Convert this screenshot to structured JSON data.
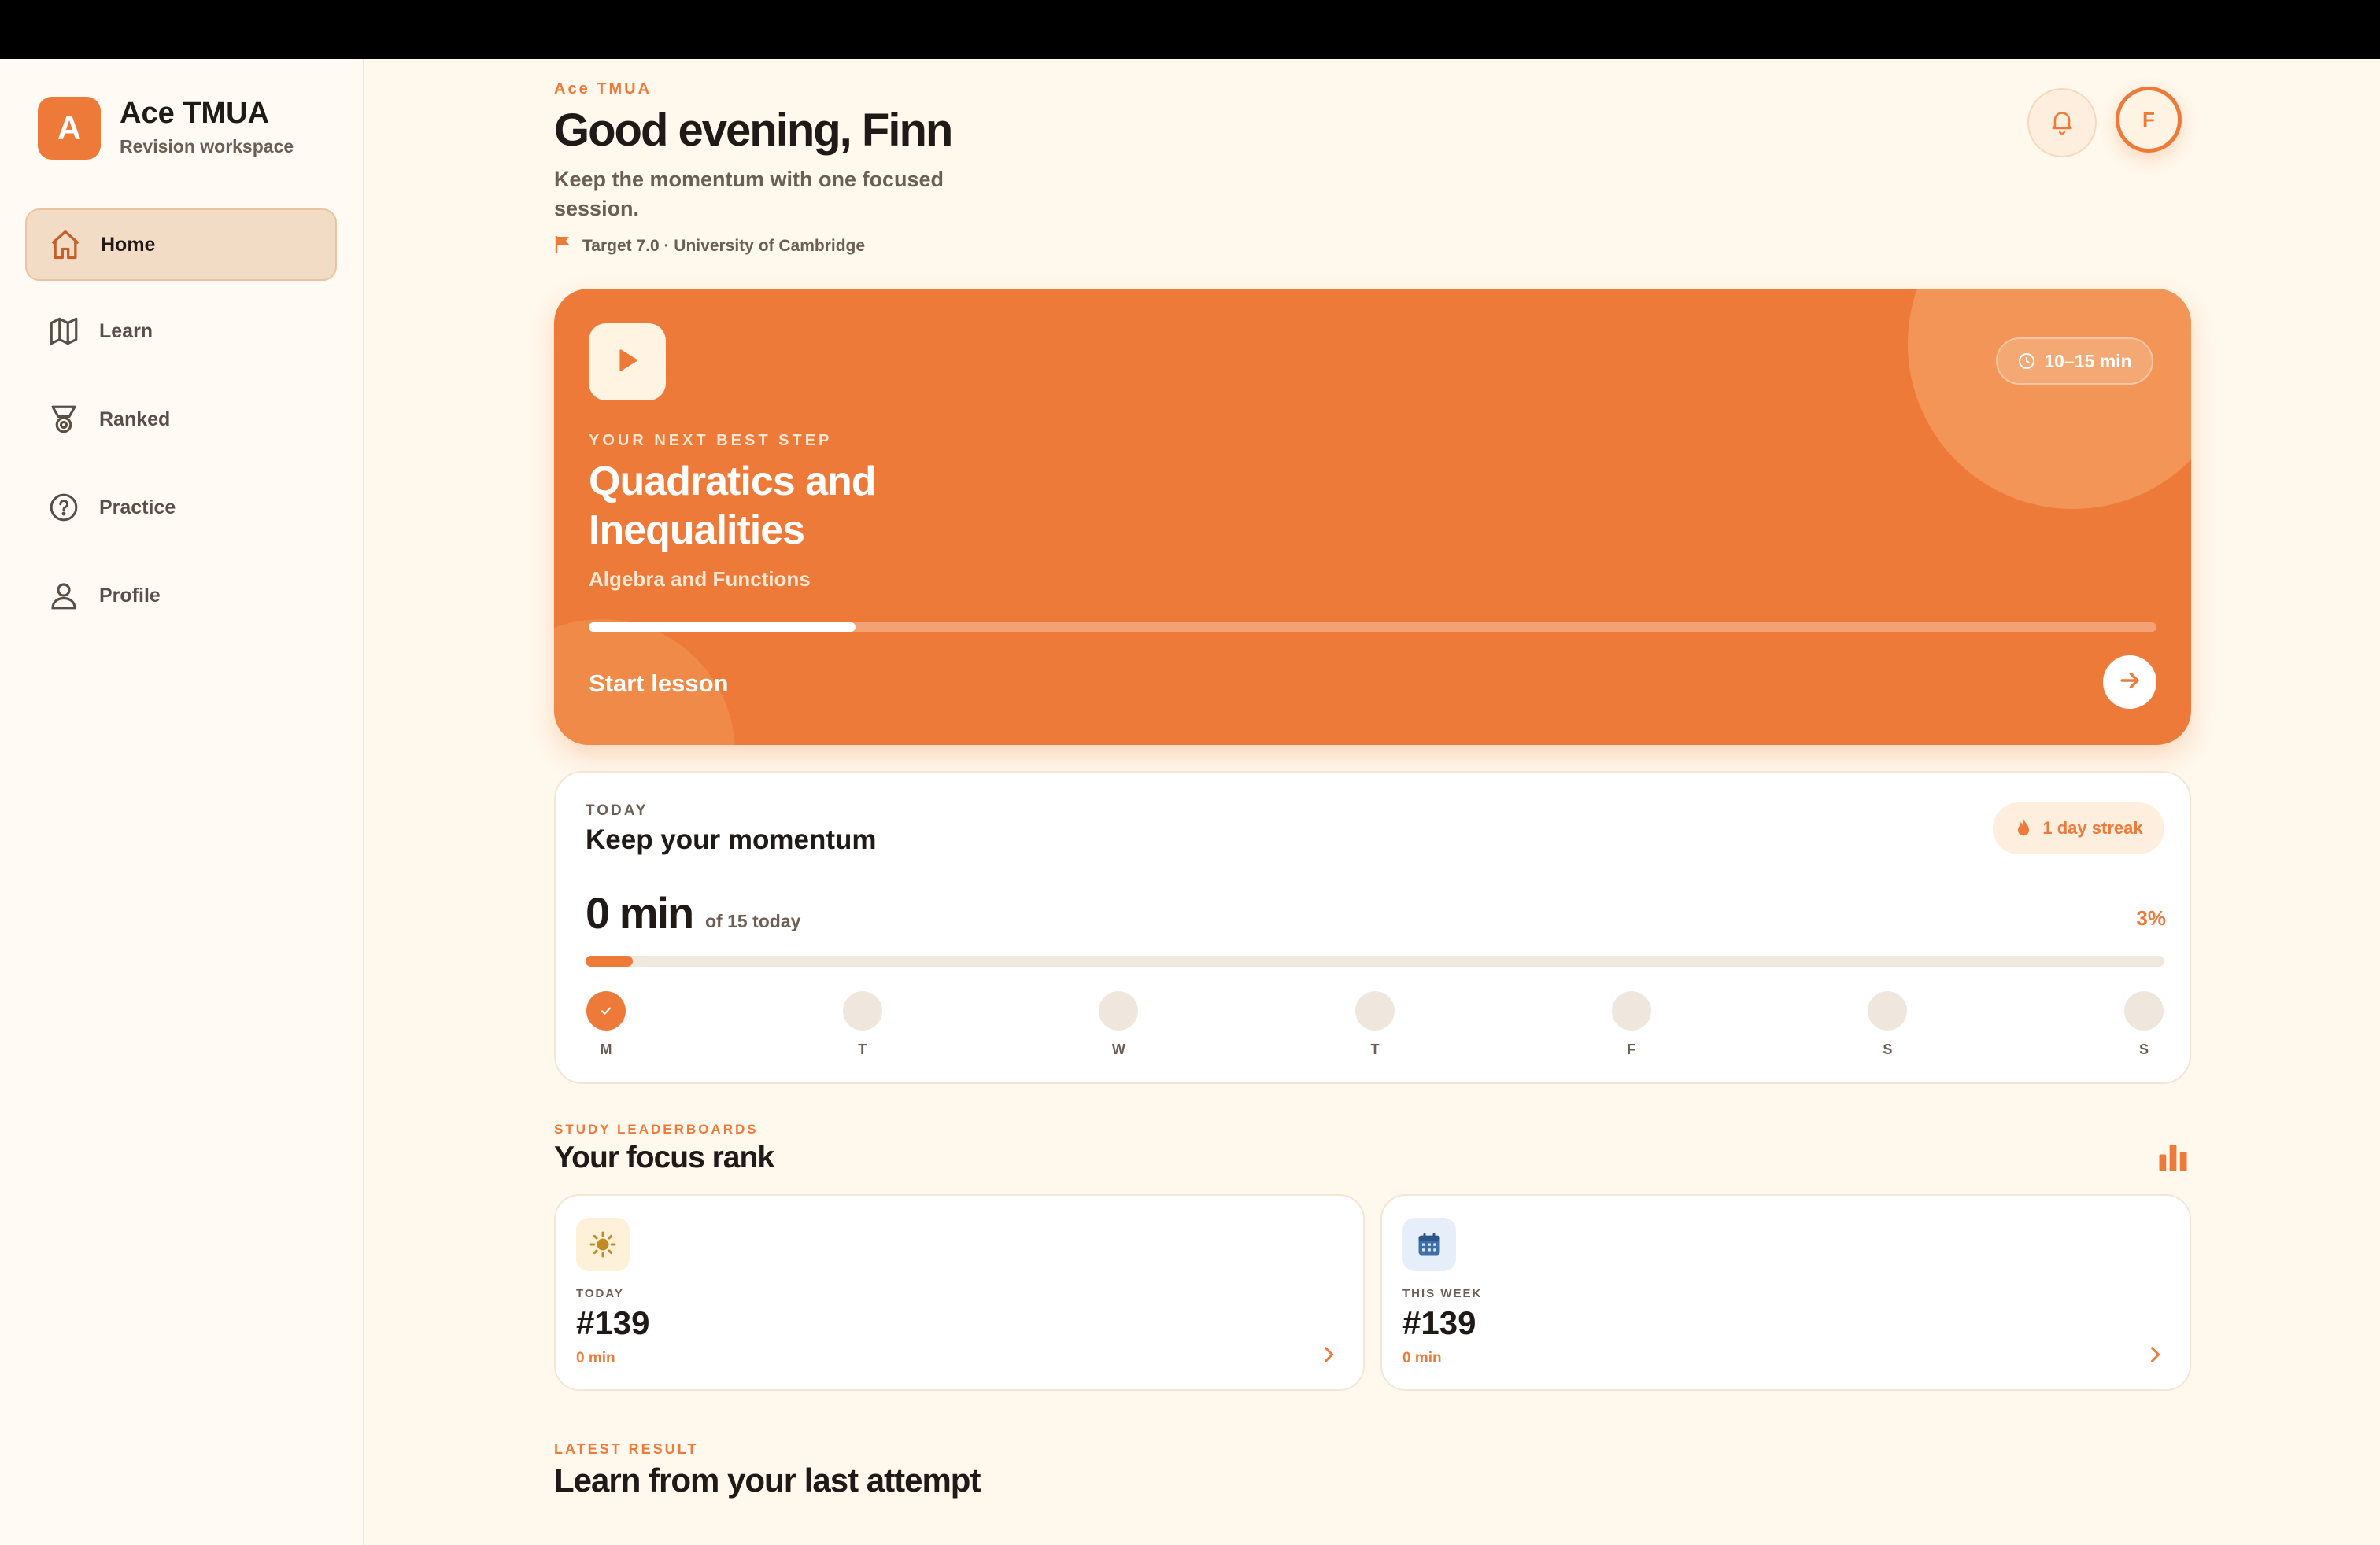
{
  "brand": {
    "logo_letter": "A",
    "title": "Ace TMUA",
    "subtitle": "Revision workspace"
  },
  "sidebar": {
    "items": [
      {
        "label": "Home",
        "icon": "home-icon",
        "active": true
      },
      {
        "label": "Learn",
        "icon": "map-icon",
        "active": false
      },
      {
        "label": "Ranked",
        "icon": "medal-icon",
        "active": false
      },
      {
        "label": "Practice",
        "icon": "question-circle-icon",
        "active": false
      },
      {
        "label": "Profile",
        "icon": "user-icon",
        "active": false
      }
    ]
  },
  "header": {
    "eyebrow": "Ace TMUA",
    "greeting": "Good evening, Finn",
    "subtitle": "Keep the momentum with one focused session.",
    "target": "Target 7.0 · University of Cambridge",
    "avatar_initial": "F"
  },
  "hero": {
    "duration": "10–15 min",
    "eyebrow": "YOUR NEXT BEST STEP",
    "title": "Quadratics and Inequalities",
    "subtitle": "Algebra and Functions",
    "progress": 0.17,
    "cta": "Start lesson"
  },
  "momentum": {
    "eyebrow": "TODAY",
    "title": "Keep your momentum",
    "streak": "1 day streak",
    "minutes": "0 min",
    "of_label": "of 15 today",
    "percent": "3%",
    "progress": 0.03,
    "days": [
      {
        "label": "M",
        "done": true
      },
      {
        "label": "T",
        "done": false
      },
      {
        "label": "W",
        "done": false
      },
      {
        "label": "T",
        "done": false
      },
      {
        "label": "F",
        "done": false
      },
      {
        "label": "S",
        "done": false
      },
      {
        "label": "S",
        "done": false
      }
    ]
  },
  "leaderboards": {
    "eyebrow": "STUDY LEADERBOARDS",
    "title": "Your focus rank",
    "cards": [
      {
        "eyebrow": "TODAY",
        "rank": "#139",
        "minutes": "0 min",
        "icon": "sun-icon"
      },
      {
        "eyebrow": "THIS WEEK",
        "rank": "#139",
        "minutes": "0 min",
        "icon": "calendar-icon"
      }
    ]
  },
  "latest_result": {
    "eyebrow": "LATEST RESULT",
    "title": "Learn from your last attempt"
  },
  "colors": {
    "accent": "#ee7a3a",
    "background": "#fff8ec",
    "sidebar_active": "#f3dcc6"
  }
}
